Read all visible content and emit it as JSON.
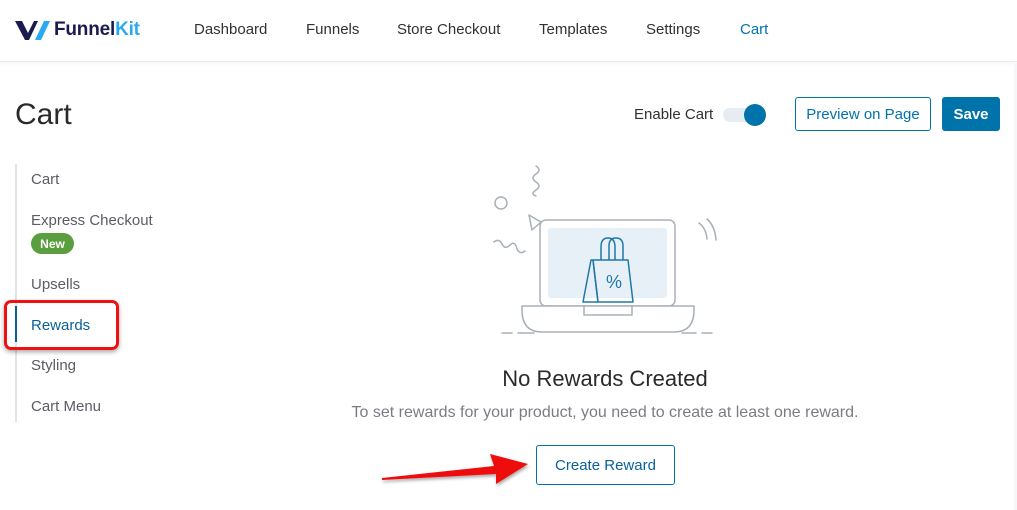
{
  "header": {
    "logo": {
      "part1": "Funnel",
      "part2": "Kit"
    },
    "nav": [
      {
        "label": "Dashboard",
        "active": false
      },
      {
        "label": "Funnels",
        "active": false
      },
      {
        "label": "Store Checkout",
        "active": false
      },
      {
        "label": "Templates",
        "active": false
      },
      {
        "label": "Settings",
        "active": false
      },
      {
        "label": "Cart",
        "active": true
      }
    ]
  },
  "page": {
    "title": "Cart",
    "enable_cart_label": "Enable Cart",
    "enable_cart_on": true,
    "preview_button": "Preview on Page",
    "save_button": "Save"
  },
  "sidebar": {
    "items": [
      {
        "label": "Cart",
        "active": false
      },
      {
        "label": "Express Checkout",
        "active": false,
        "badge": "New"
      },
      {
        "label": "Upsells",
        "active": false
      },
      {
        "label": "Rewards",
        "active": true
      },
      {
        "label": "Styling",
        "active": false
      },
      {
        "label": "Cart Menu",
        "active": false
      }
    ]
  },
  "empty_state": {
    "title": "No Rewards Created",
    "description": "To set rewards for your product, you need to create at least one reward.",
    "button": "Create Reward",
    "illustration_symbol": "%"
  },
  "colors": {
    "accent": "#0073aa",
    "badge_green": "#5a9e3e",
    "logo_dark": "#1c1b4f",
    "logo_light": "#29aaf0",
    "annotation_red": "#ee1111"
  }
}
